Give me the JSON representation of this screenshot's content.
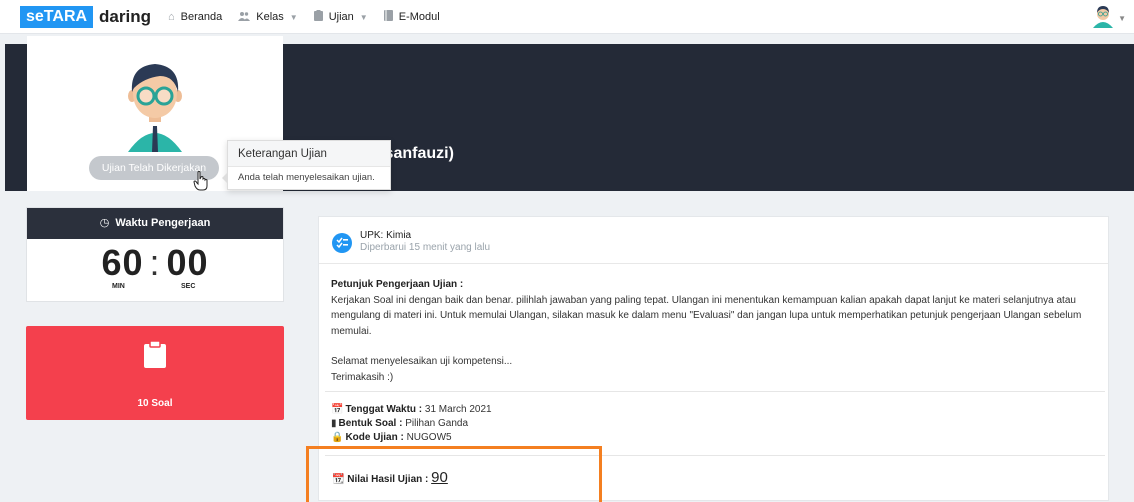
{
  "navbar": {
    "logo_box": "seTARA",
    "logo_text": "daring",
    "items": [
      {
        "label": "Beranda",
        "icon": "home-icon",
        "dropdown": false
      },
      {
        "label": "Kelas",
        "icon": "users-icon",
        "dropdown": true
      },
      {
        "label": "Ujian",
        "icon": "clipboard-icon",
        "dropdown": true
      },
      {
        "label": "E-Modul",
        "icon": "book-icon",
        "dropdown": false
      }
    ]
  },
  "banner": {
    "username": "(ihsanfauzi)"
  },
  "profile": {
    "button_label": "Ujian Telah Dikerjakan"
  },
  "popover": {
    "title": "Keterangan Ujian",
    "body": "Anda telah menyelesaikan ujian."
  },
  "timer": {
    "title": "Waktu Pengerjaan",
    "minutes": "60",
    "seconds": "00",
    "min_label": "MIN",
    "sec_label": "SEC"
  },
  "soal": {
    "label": "10 Soal"
  },
  "exam": {
    "title": "UPK: Kimia",
    "updated": "Diperbarui 15 menit yang lalu",
    "instr_title": "Petunjuk Pengerjaan Ujian :",
    "instr_text": "Kerjakan Soal ini dengan baik dan benar. pilihlah jawaban yang paling tepat. Ulangan ini menentukan kemampuan kalian apakah dapat lanjut ke materi selanjutnya atau mengulang di materi ini. Untuk memulai Ulangan, silakan masuk ke dalam menu \"Evaluasi\" dan jangan lupa untuk memperhatikan petunjuk pengerjaan Ulangan sebelum memulai.",
    "greeting": "Selamat menyelesaikan uji kompetensi...",
    "thanks": "Terimakasih :)",
    "deadline_label": "Tenggat Waktu :",
    "deadline_value": "31 March 2021",
    "form_label": "Bentuk Soal :",
    "form_value": "Pilihan Ganda",
    "code_label": "Kode Ujian :",
    "code_value": "NUGOW5",
    "score_label": "Nilai Hasil Ujian :",
    "score_value": "90"
  },
  "colors": {
    "accent": "#2196f3",
    "banner": "#242a37",
    "danger": "#f4404d",
    "highlight": "#f47f20"
  }
}
